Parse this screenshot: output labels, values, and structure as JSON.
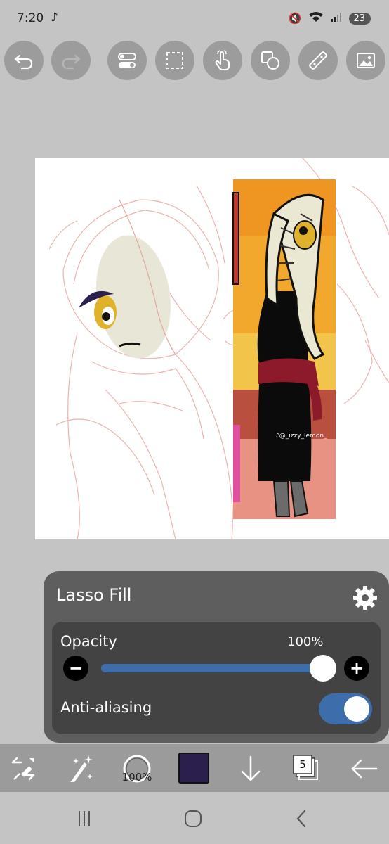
{
  "status_bar": {
    "time": "7:20",
    "battery": "23"
  },
  "toolbar": {
    "undo": "undo-icon",
    "redo": "redo-icon",
    "toggles": "toggle-settings-icon",
    "selection": "selection-icon",
    "touch": "touch-gesture-icon",
    "shapes": "shapes-icon",
    "ruler": "ruler-icon",
    "image": "image-icon"
  },
  "canvas": {
    "watermark": "@_izzy_lemon_"
  },
  "panel": {
    "title": "Lasso Fill",
    "opacity_label": "Opacity",
    "opacity_value": "100%",
    "opacity_level": 1.0,
    "anti_aliasing_label": "Anti-aliasing",
    "anti_aliasing_on": true
  },
  "bottom_bar": {
    "brush_size": "100%",
    "color": "#2b1f4d",
    "layer_count": "5"
  },
  "colors": {
    "accent": "#3e6dab",
    "panel": "#5e5e5e",
    "toolbar_button": "#9c9c9c"
  }
}
